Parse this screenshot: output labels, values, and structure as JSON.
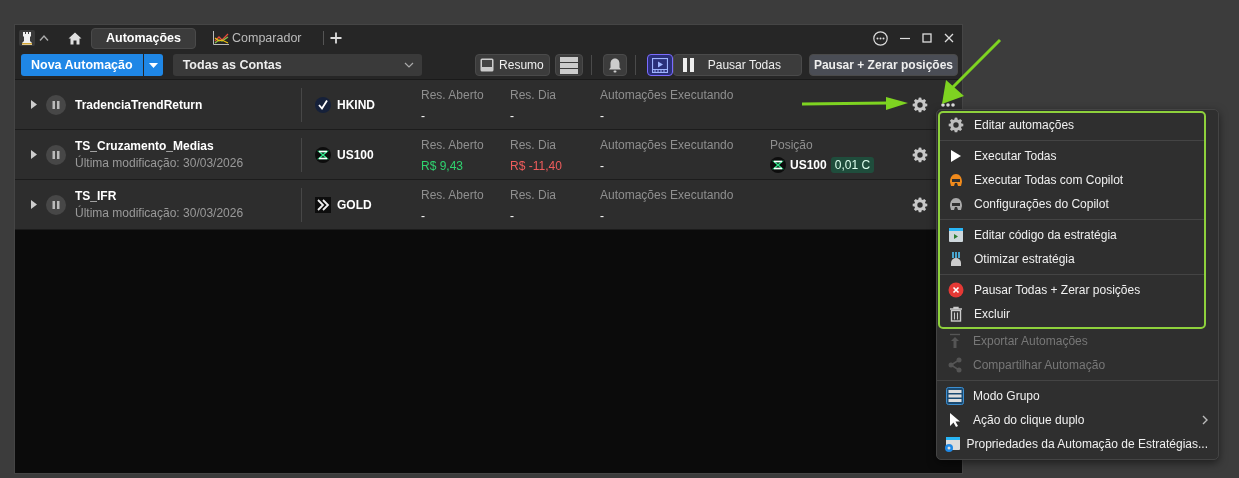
{
  "title_bar": {
    "tabs": [
      {
        "kind": "plain",
        "label": "Automações",
        "selected": true
      },
      {
        "kind": "chart",
        "label": "Comparador",
        "selected": false
      }
    ]
  },
  "toolbar": {
    "new_button": "Nova Automação",
    "account_select": "Todas as Contas",
    "buttons": [
      {
        "kind": "panel",
        "label": "Resumo",
        "on": false
      },
      {
        "kind": "list",
        "on": false
      },
      {
        "kind": "bell",
        "on": false
      },
      {
        "kind": "video",
        "on": true
      },
      {
        "kind": "pause",
        "label": "Pausar Todas",
        "on": false
      },
      {
        "kind": "emphasis",
        "label": "Pausar + Zerar posições",
        "on": false
      }
    ]
  },
  "rows": [
    {
      "name": "TradenciaTrendReturn",
      "expanded": false,
      "more_button": true,
      "symbol": {
        "kind": "check",
        "code": "HKIND"
      },
      "metrics": [
        {
          "label": "Res. Aberto",
          "value": "-"
        },
        {
          "label": "Res. Dia",
          "value": "-"
        },
        {
          "label": "Automações Executando",
          "value": "-"
        }
      ]
    },
    {
      "name": "TS_Cruzamento_Medias",
      "modified": "Última modificação: 30/03/2026",
      "expanded": false,
      "symbol": {
        "kind": "index",
        "code": "US100"
      },
      "metrics": [
        {
          "label": "Res. Aberto",
          "value": "R$ 9,43",
          "color": "#2fd36f"
        },
        {
          "label": "Res. Dia",
          "value": "R$ -11,40",
          "color": "#f05c5c"
        },
        {
          "label": "Automações Executando",
          "value": "-"
        }
      ],
      "position": {
        "label": "Posição",
        "code": "US100",
        "quantity": "0,01 C"
      }
    },
    {
      "name": "TS_IFR",
      "modified": "Última modificação: 30/03/2026",
      "expanded": false,
      "symbol": {
        "kind": "arrows",
        "code": "GOLD"
      },
      "metrics": [
        {
          "label": "Res. Aberto",
          "value": "-"
        },
        {
          "label": "Res. Dia",
          "value": "-"
        },
        {
          "label": "Automações Executando",
          "value": "-"
        }
      ]
    }
  ],
  "context_menu": {
    "groups": [
      {
        "highlighted": true,
        "items": [
          {
            "kind": "settings",
            "label": "Editar automações",
            "disabled": false
          }
        ]
      },
      {
        "highlighted": true,
        "items": [
          {
            "kind": "run",
            "label": "Executar Todas",
            "disabled": false
          },
          {
            "kind": "copilot",
            "label": "Executar Todas com Copilot",
            "disabled": false
          },
          {
            "kind": "copilotconfig",
            "label": "Configurações do Copilot",
            "disabled": false
          }
        ]
      },
      {
        "highlighted": true,
        "items": [
          {
            "kind": "code",
            "label": "Editar código da estratégia",
            "disabled": false
          },
          {
            "kind": "optimize",
            "label": "Otimizar estratégia",
            "disabled": false
          }
        ]
      },
      {
        "highlighted": true,
        "items": [
          {
            "kind": "stop",
            "label": "Pausar Todas + Zerar posições",
            "disabled": false
          },
          {
            "kind": "delete",
            "label": "Excluir",
            "disabled": false
          }
        ]
      },
      {
        "highlighted": false,
        "items": [
          {
            "kind": "export",
            "label": "Exportar Automações",
            "disabled": true
          },
          {
            "kind": "share",
            "label": "Compartilhar Automação",
            "disabled": true
          }
        ]
      },
      {
        "highlighted": false,
        "items": [
          {
            "kind": "group",
            "label": "Modo Grupo",
            "disabled": false
          },
          {
            "kind": "cursor",
            "label": "Ação do clique duplo",
            "disabled": false,
            "submenu": true
          },
          {
            "kind": "properties",
            "label": "Propriedades da Automação de Estratégias...",
            "disabled": false
          }
        ]
      }
    ]
  }
}
